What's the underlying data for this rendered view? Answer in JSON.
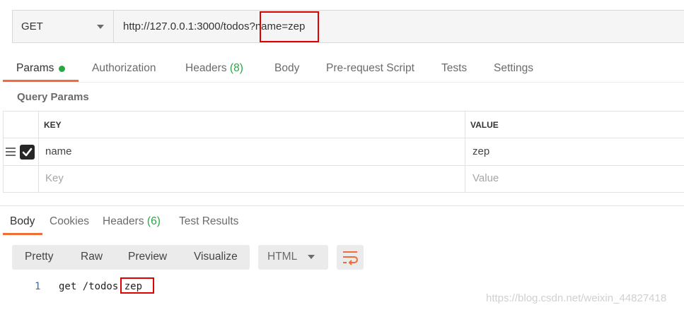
{
  "request": {
    "method": "GET",
    "url": "http://127.0.0.1:3000/todos?name=zep"
  },
  "request_tabs": [
    {
      "label": "Params",
      "active": true
    },
    {
      "label": "Authorization"
    },
    {
      "label": "Headers",
      "count": "(8)"
    },
    {
      "label": "Body"
    },
    {
      "label": "Pre-request Script"
    },
    {
      "label": "Tests"
    },
    {
      "label": "Settings"
    }
  ],
  "query_params": {
    "title": "Query Params",
    "columns": {
      "key": "KEY",
      "value": "VALUE"
    },
    "rows": [
      {
        "key": "name",
        "value": "zep",
        "checked": true
      }
    ],
    "placeholders": {
      "key": "Key",
      "value": "Value"
    }
  },
  "response_tabs": [
    {
      "label": "Body",
      "active": true
    },
    {
      "label": "Cookies"
    },
    {
      "label": "Headers",
      "count": "(6)"
    },
    {
      "label": "Test Results"
    }
  ],
  "response_toolbar": {
    "formats": [
      "Pretty",
      "Raw",
      "Preview",
      "Visualize"
    ],
    "language": "HTML"
  },
  "response_body": {
    "line_number": "1",
    "code": "get /todos zep"
  },
  "watermark": "https://blog.csdn.net/weixin_44827418",
  "colors": {
    "accent": "#f26b3a",
    "highlight_box": "#e00000",
    "green": "#28a745"
  }
}
